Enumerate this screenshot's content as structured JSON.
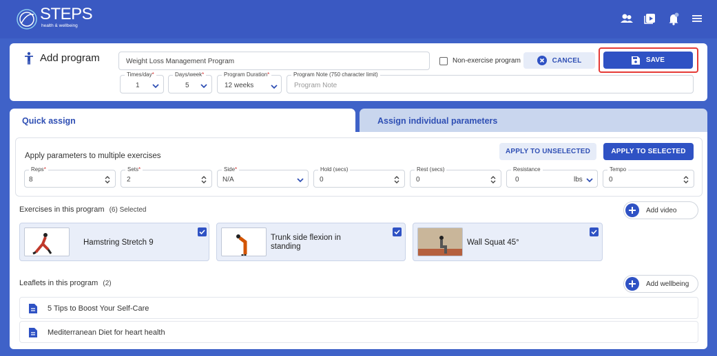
{
  "brand": {
    "name": "STEPS",
    "tagline": "health & wellbeing"
  },
  "topbar": {
    "icons": [
      "users-icon",
      "video-library-icon",
      "notifications-icon",
      "menu-icon"
    ]
  },
  "header": {
    "title": "Add program",
    "program_name": "Weight Loss Management Program",
    "non_exercise_label": "Non-exercise program",
    "non_exercise_checked": false,
    "cancel_label": "CANCEL",
    "save_label": "SAVE",
    "times_per_day": {
      "label": "Times/day",
      "value": "1"
    },
    "days_per_week": {
      "label": "Days/week",
      "value": "5"
    },
    "duration": {
      "label": "Program Duration",
      "value": "12 weeks"
    },
    "note": {
      "label": "Program Note (750 character limit)",
      "placeholder": "Program Note"
    }
  },
  "tabs": [
    {
      "label": "Quick assign",
      "active": true
    },
    {
      "label": "Assign individual parameters",
      "active": false
    }
  ],
  "quick_assign": {
    "title": "Apply parameters to multiple exercises",
    "apply_unselected": "APPLY TO UNSELECTED",
    "apply_selected": "APPLY TO SELECTED",
    "fields": [
      {
        "label": "Reps",
        "required": true,
        "value": "8"
      },
      {
        "label": "Sets",
        "required": true,
        "value": "2"
      },
      {
        "label": "Side",
        "required": true,
        "value": "N/A"
      },
      {
        "label": "Hold (secs)",
        "required": false,
        "value": "0"
      },
      {
        "label": "Rest (secs)",
        "required": false,
        "value": "0"
      },
      {
        "label": "Resistance",
        "required": false,
        "value": "0",
        "unit": "lbs"
      },
      {
        "label": "Tempo",
        "required": false,
        "value": "0"
      }
    ]
  },
  "exercises": {
    "title": "Exercises in this program",
    "count": "(6) Selected",
    "add_label": "Add video",
    "items": [
      {
        "name": "Hamstring Stretch 9",
        "checked": true
      },
      {
        "name": "Trunk side flexion in",
        "name2": "standing",
        "checked": true
      },
      {
        "name": "Wall Squat 45°",
        "checked": true
      }
    ]
  },
  "leaflets": {
    "title": "Leaflets in this program",
    "count": "(2)",
    "add_label": "Add wellbeing",
    "items": [
      {
        "name": "5 Tips to Boost Your Self-Care"
      },
      {
        "name": "Mediterranean Diet for heart health"
      }
    ]
  },
  "colors": {
    "brand_blue": "#3a59c2",
    "primary_button": "#2f52c4",
    "highlight": "#e53935"
  }
}
